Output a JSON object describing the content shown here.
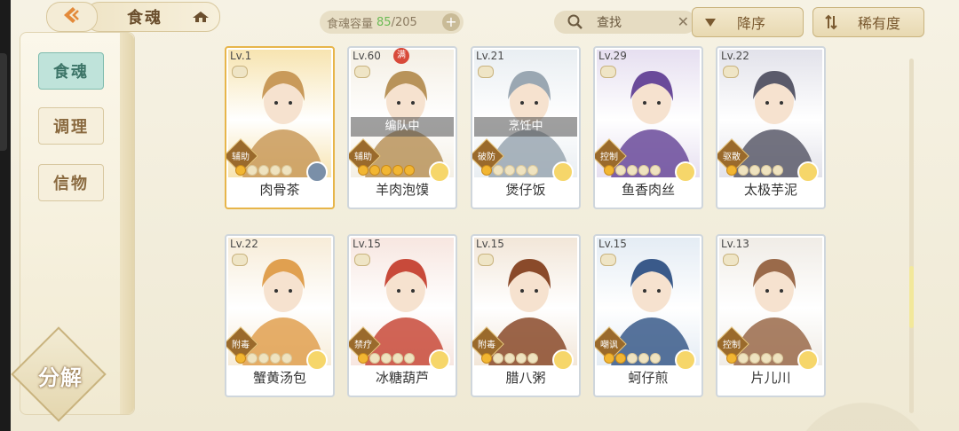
{
  "header": {
    "title": "食魂",
    "capacity_label": "食魂容量",
    "capacity_current": "85",
    "capacity_max": "/205",
    "search_label": "查找",
    "sort_desc_label": "降序",
    "sort_rarity_label": "稀有度"
  },
  "nav": {
    "items": [
      {
        "label": "食魂",
        "active": true
      },
      {
        "label": "调理",
        "active": false
      },
      {
        "label": "信物",
        "active": false
      }
    ],
    "decompose_label": "分解"
  },
  "cards": [
    {
      "level": "Lv.1",
      "role": "辅助",
      "name": "肉骨茶",
      "status": "",
      "full": "",
      "selected": true,
      "palette": [
        "#f7e4b0",
        "#c99a5a"
      ],
      "stars_filled": 1,
      "element_color": "#7a8fa8"
    },
    {
      "level": "Lv.60",
      "role": "辅助",
      "name": "羊肉泡馍",
      "status": "编队中",
      "full": "满",
      "selected": false,
      "palette": [
        "#f4efe4",
        "#b8935a"
      ],
      "stars_filled": 5,
      "element_color": "#f6d66a"
    },
    {
      "level": "Lv.21",
      "role": "破防",
      "name": "煲仔饭",
      "status": "烹饪中",
      "full": "",
      "selected": false,
      "palette": [
        "#e9eef2",
        "#9aa7b2"
      ],
      "stars_filled": 1,
      "element_color": "#f6d66a"
    },
    {
      "level": "Lv.29",
      "role": "控制",
      "name": "鱼香肉丝",
      "status": "",
      "full": "",
      "selected": false,
      "palette": [
        "#e6dff0",
        "#6a4a9a"
      ],
      "stars_filled": 1,
      "element_color": "#f6d66a"
    },
    {
      "level": "Lv.22",
      "role": "驱散",
      "name": "太极芋泥",
      "status": "",
      "full": "",
      "selected": false,
      "palette": [
        "#e2e2ea",
        "#5a5a6a"
      ],
      "stars_filled": 1,
      "element_color": "#f6d66a"
    },
    {
      "level": "Lv.22",
      "role": "附毒",
      "name": "蟹黄汤包",
      "status": "",
      "full": "",
      "selected": false,
      "palette": [
        "#f7ecd8",
        "#e0a050"
      ],
      "stars_filled": 1,
      "element_color": "#f6d66a"
    },
    {
      "level": "Lv.15",
      "role": "禁疗",
      "name": "冰糖葫芦",
      "status": "",
      "full": "",
      "selected": false,
      "palette": [
        "#f7e6e0",
        "#c84a3a"
      ],
      "stars_filled": 1,
      "element_color": "#f6d66a"
    },
    {
      "level": "Lv.15",
      "role": "附毒",
      "name": "腊八粥",
      "status": "",
      "full": "",
      "selected": false,
      "palette": [
        "#f2e6d8",
        "#8a4a2a"
      ],
      "stars_filled": 1,
      "element_color": "#f6d66a"
    },
    {
      "level": "Lv.15",
      "role": "嘲讽",
      "name": "蚵仔煎",
      "status": "",
      "full": "",
      "selected": false,
      "palette": [
        "#e4ecf4",
        "#3a5a8a"
      ],
      "stars_filled": 2,
      "element_color": "#f6d66a"
    },
    {
      "level": "Lv.13",
      "role": "控制",
      "name": "片儿川",
      "status": "",
      "full": "",
      "selected": false,
      "palette": [
        "#f0ece6",
        "#9a6a4a"
      ],
      "stars_filled": 1,
      "element_color": "#f6d66a"
    }
  ]
}
